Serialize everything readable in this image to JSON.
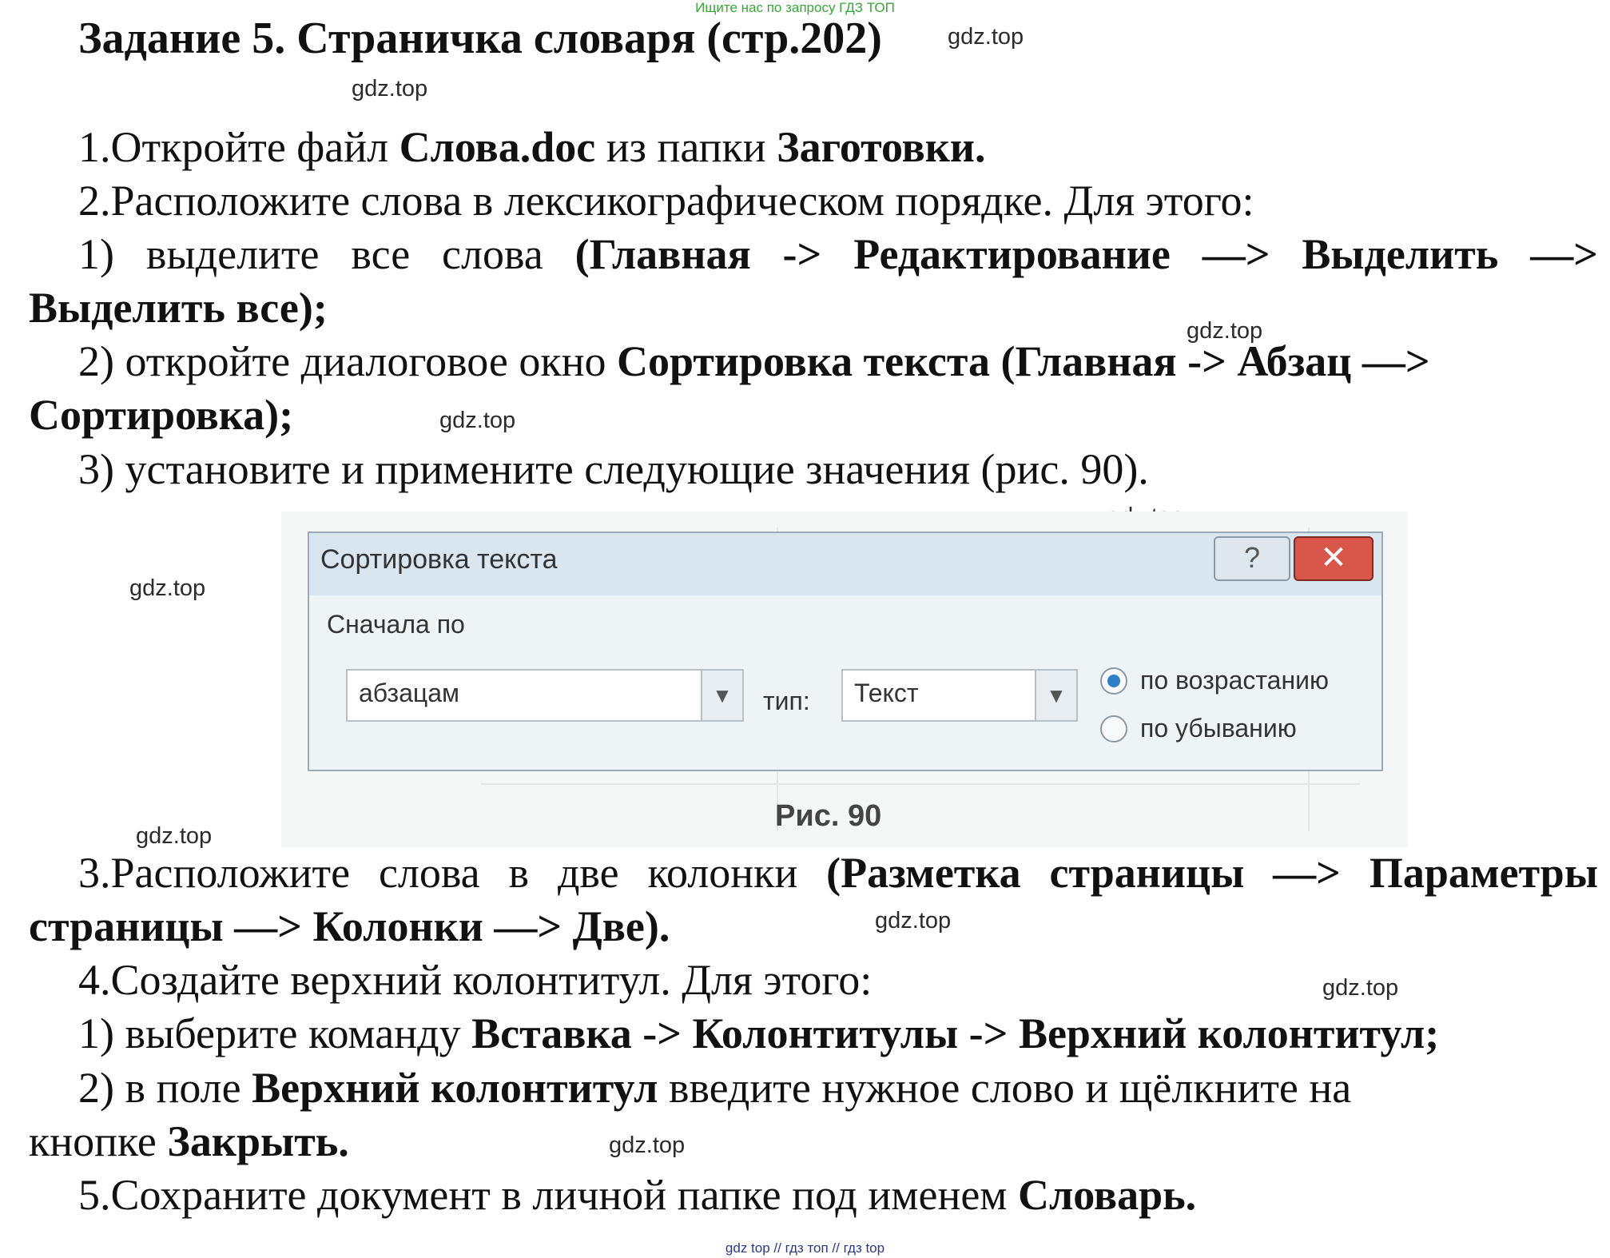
{
  "banner": "Ищите нас по запросу ГДЗ ТОП",
  "title": "Задание 5. Страничка словаря (стр.202)",
  "watermark": "gdz.top",
  "footer": "gdz top // гдз топ // гдз top",
  "step1": {
    "t1": "1.Откройте файл ",
    "b1": "Слова.doc",
    "t2": " из папки ",
    "b2": "Заготовки."
  },
  "step2": {
    "t1": "2.Расположите слова в лексикографическом порядке. Для этого:"
  },
  "sub1": {
    "t1": "1) выделите все слова ",
    "b1": "(Главная -> Редактирование —> Выделить —>",
    "b2": "Выделить все);"
  },
  "sub2": {
    "t1": "2) откройте диалоговое окно ",
    "b1": "Сортировка текста (Главная -> Абзац —>",
    "b2": "Сортировка);"
  },
  "sub3": {
    "t1": "3) установите и примените следующие значения (рис. 90)."
  },
  "dialog": {
    "title": "Сортировка текста",
    "help_label": "?",
    "close_label": "✕",
    "sort_by_label": "Сначала по",
    "sort_by_value": "абзацам",
    "type_label": "тип:",
    "type_value": "Текст",
    "asc_label": "по возрастанию",
    "desc_label": "по убыванию",
    "selected_order": "по возрастанию"
  },
  "figure_caption": "Рис. 90",
  "step3": {
    "t1": "3.Расположите слова в две колонки ",
    "b1": "(Разметка страницы —> Параметры",
    "b2": "страницы —> Колонки —> Две)."
  },
  "step4": {
    "t1": "4.Создайте верхний колонтитул. Для этого:"
  },
  "sub4": {
    "t1": "1) выберите команду ",
    "b1": "Вставка -> Колонтитулы -> Верхний колонтитул;"
  },
  "sub5": {
    "t1": "2) в поле ",
    "b1": "Верхний колонтитул",
    "t2": " введите нужное слово и щёлкните на",
    "t3": "кнопке ",
    "b2": "Закрыть."
  },
  "step5": {
    "t1": "5.Сохраните документ в личной папке под именем ",
    "b1": "Словарь."
  },
  "colors": {
    "banner": "#3aa63a",
    "footer": "#2a3a8a",
    "close_button": "#d9564a",
    "dialog_titlebar": "#d9e6f0",
    "radio_selected": "#2f7fc7"
  },
  "icons": [
    "help-icon",
    "close-icon",
    "dropdown-arrow-icon",
    "radio-selected-icon",
    "radio-unselected-icon"
  ]
}
